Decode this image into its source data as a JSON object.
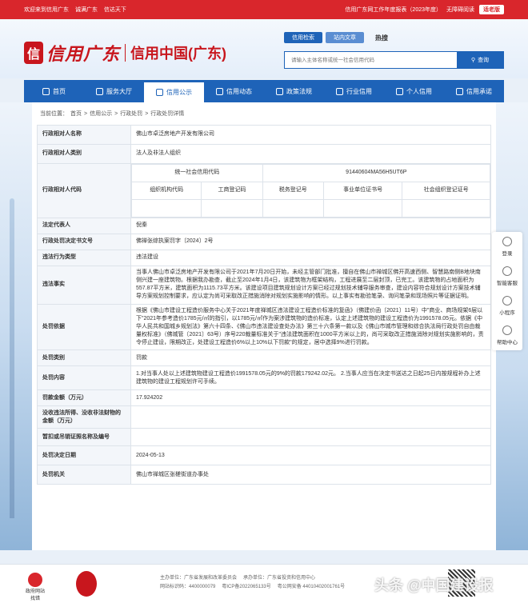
{
  "topbar": {
    "welcome": "欢迎来到信用广东",
    "links": [
      "诚满广东",
      "信达天下"
    ],
    "report": "信用广东网工作年度报表（2023年度）",
    "accessibility": "无障碍阅读",
    "badge": "适老版"
  },
  "logo": {
    "mark": "信",
    "text1": "信用广东",
    "text2": "信用中国(广东)"
  },
  "search": {
    "tabs": [
      "信用检索",
      "站内文章"
    ],
    "extra": "热搜",
    "placeholder": "请输入主体名称或统一社会信用代码",
    "button": "查询"
  },
  "nav": [
    "首页",
    "服务大厅",
    "信用公示",
    "信用动态",
    "政策法规",
    "行业信用",
    "个人信用",
    "信用承诺"
  ],
  "nav_active": 2,
  "breadcrumb": {
    "prefix": "当前位置：",
    "items": [
      "首页",
      "信用公示",
      "行政处罚",
      "行政处罚详情"
    ],
    "sep": ">"
  },
  "record": {
    "name_label": "行政相对人名称",
    "name": "佛山市卓泛房地产开发有限公司",
    "type_label": "行政相对人类别",
    "type": "法人及非法人组织",
    "code_label": "行政相对人代码",
    "uscc_label": "统一社会信用代码",
    "uscc": "91440604MA56H5UT6P",
    "code_headers": [
      "组织机构代码",
      "工商登记码",
      "税务登记号",
      "事业单位证书号",
      "社会组织登记证号"
    ],
    "rep_label": "法定代表人",
    "rep": "倪秦",
    "doc_label": "行政处罚决定书文号",
    "doc": "佛禅张综执案罚字〔2024〕2号",
    "violation_type_label": "违法行为类型",
    "violation_type": "违法建设",
    "facts_label": "违法事实",
    "facts": "当事人佛山市卓泛房地产开发有限公司于2021年7月20日开始，未经主管部门批准，擅自在佛山市禅城区佛开高速西侧、智慧路南侧B地块南侧兴建一座建筑物。根据我办勘查，截止至2024年1月4日，该建筑物为框架结构，工程进展至二层封顶，已完工。该建筑物的占地面积为557.87平方米，建筑面积为1115.73平方米。该建设项目建筑规划设计方案已经过规划技术辅导服务审查，建设内容符合规划设计方案技术辅导方案规划控制要求，应认定为尚可采取改正措施消除对规划实施影响的情形。以上事实有勘验笔录、询问笔录和现场照片等证据证明。",
    "basis_label": "处罚依据",
    "basis": "根据《佛山市建设工程造价服务中心关于2021年度禅城区违法建设工程造价标准的复函》（佛建价函〔2021〕11号）中\"商业、商场规架6层以下\"2021年参考造价1785元/㎡的指引，以1785元/㎡作为案涉建筑物的造价标准，认定上述建筑物的建设工程造价为1991578.05元。依据《中华人民共和国城乡规划法》第六十四条、《佛山市违法建设查处办法》第三十六条第一款以及《佛山市城市管理和综合执法局行政处罚自由裁量权标准》（佛城管〔2021〕63号）序号220裁量标准关于\"违法建筑面积在1000平方米以上的，尚可采取改正措施消除对规划实施影响的，责令停止建设，限期改正，处建设工程造价6%以上10%以下罚款\"的规定，居中选择9%进行罚款。",
    "category_label": "处罚类别",
    "category": "罚款",
    "content_label": "处罚内容",
    "content": "1.对当事人处以上述建筑物建设工程造价1991578.05元的9%的罚款179242.02元。 2.当事人应当在决定书送达之日起25日内按规程补办上述建筑物的建设工程规划许可手续。",
    "amount_label": "罚款金额（万元）",
    "amount": "17.924202",
    "confiscate_label": "没收违法所得、没收非法财物的金额（万元）",
    "confiscate": "",
    "license_label": "暂扣或吊销证照名称及编号",
    "license": "",
    "date_label": "处罚决定日期",
    "date": "2024-05-13",
    "authority_label": "处罚机关",
    "authority": "佛山市禅城区张槎街道办事处"
  },
  "float_bar": [
    "登录",
    "智能客服",
    "小程序",
    "帮助中心"
  ],
  "footer": {
    "gov_label": "政府网站",
    "gov_sub": "找错",
    "sponsor": "主办单位：广东省发展和改革委员会",
    "operator": "承办单位：广东省投资和信用中心",
    "site_code": "网站标识码：4400000079",
    "icp": "粤ICP备2022065133号",
    "police": "粤公网安备 44010402001761号"
  },
  "watermark": "头条 @中国建设报"
}
